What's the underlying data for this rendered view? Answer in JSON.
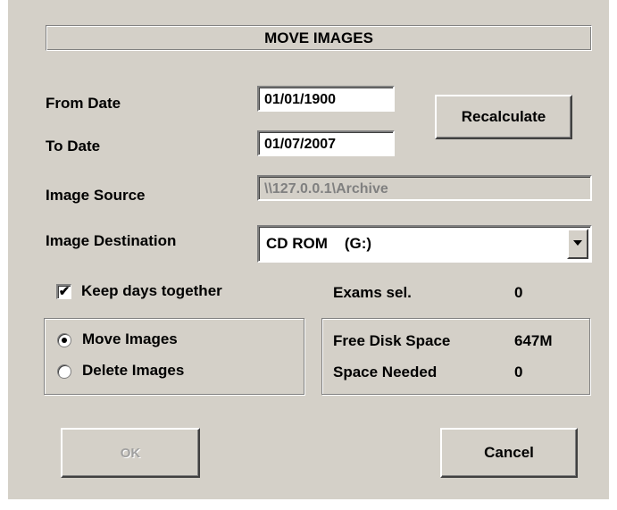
{
  "dialog": {
    "title": "MOVE IMAGES"
  },
  "fields": {
    "from_date": {
      "label": "From Date",
      "value": "01/01/1900"
    },
    "to_date": {
      "label": "To Date",
      "value": "01/07/2007"
    },
    "image_source": {
      "label": "Image Source",
      "value": "\\\\127.0.0.1\\Archive"
    },
    "image_destination": {
      "label": "Image Destination",
      "value": "CD ROM    (G:)",
      "dropdown_icon": "chevron-down-icon"
    }
  },
  "buttons": {
    "recalculate": "Recalculate",
    "ok": "OK",
    "cancel": "Cancel"
  },
  "options": {
    "keep_days_together": {
      "label": "Keep days together",
      "checked": true
    },
    "mode": {
      "move_images": {
        "label": "Move Images",
        "selected": true
      },
      "delete_images": {
        "label": "Delete Images",
        "selected": false
      }
    }
  },
  "stats": {
    "exams_sel": {
      "label": "Exams sel.",
      "value": "0"
    },
    "free_disk_space": {
      "label": "Free Disk Space",
      "value": "647M"
    },
    "space_needed": {
      "label": "Space Needed",
      "value": "0"
    }
  },
  "colors": {
    "dialog_bg": "#d4d0c8",
    "field_bg": "#ffffff",
    "disabled_text": "#808080"
  }
}
